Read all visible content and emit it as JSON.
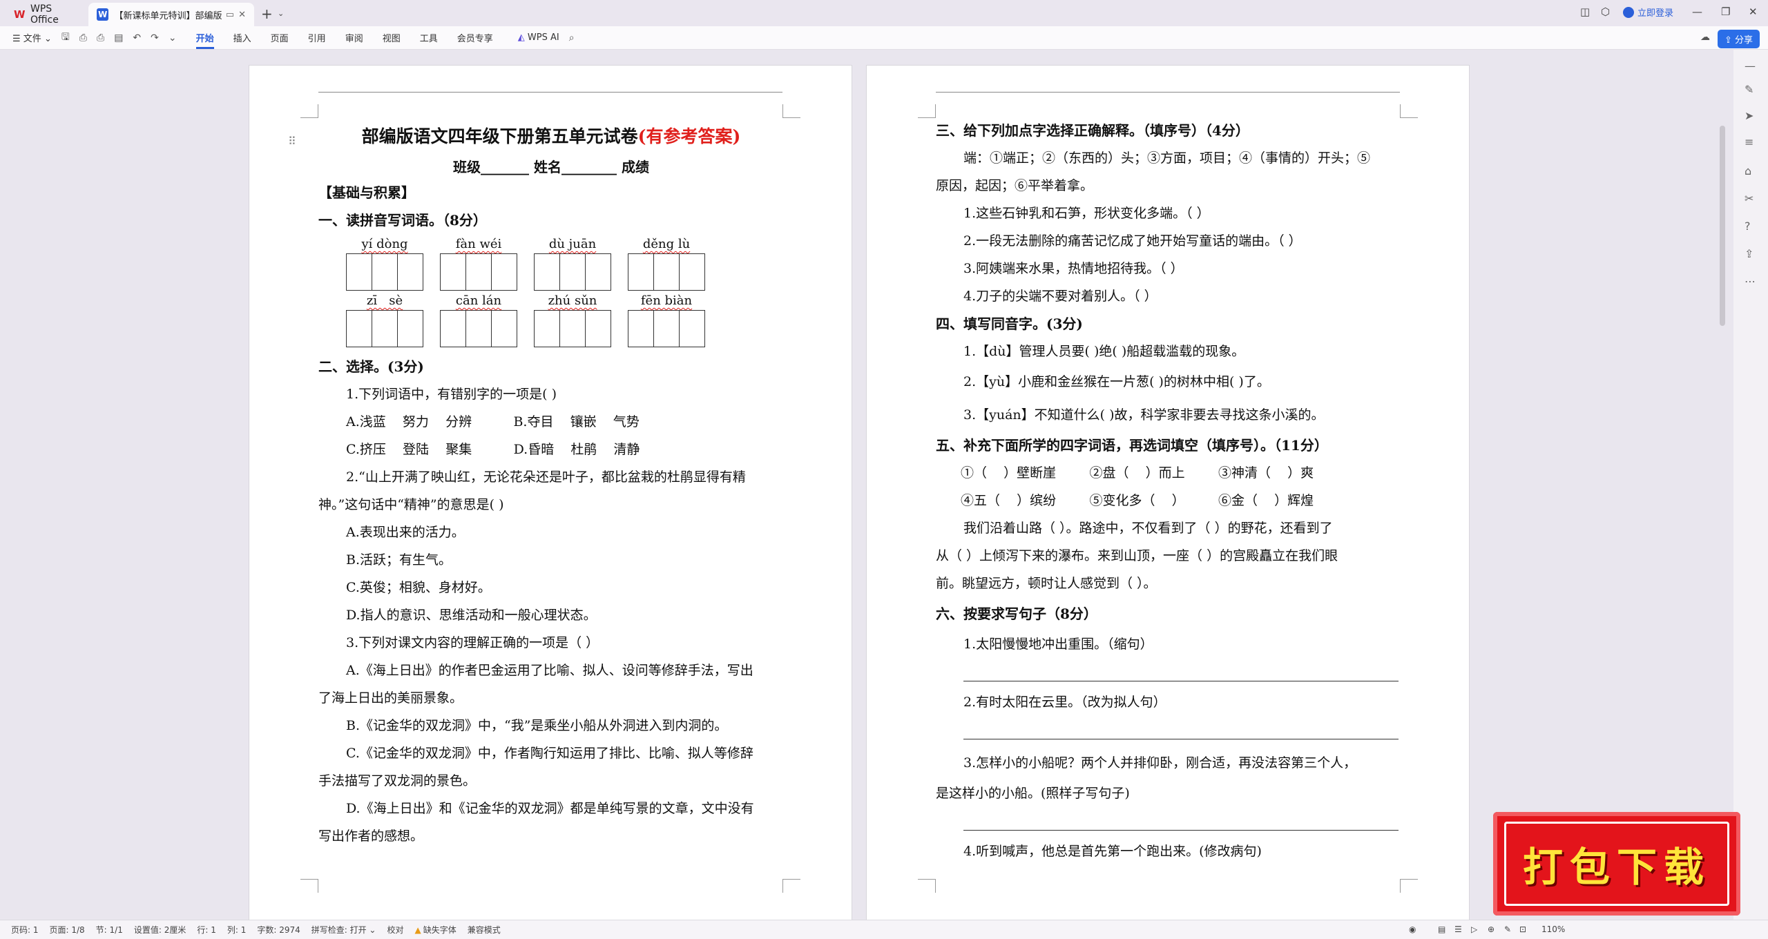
{
  "titlebar": {
    "home_tab": "WPS Office",
    "doc_tab": "【新课标单元特训】部编版语",
    "login": "立即登录"
  },
  "toolbar": {
    "file": "文件",
    "tabs": [
      "开始",
      "插入",
      "页面",
      "引用",
      "审阅",
      "视图",
      "工具",
      "会员专享"
    ],
    "active_tab": "开始",
    "ai": "WPS AI",
    "share": "分享"
  },
  "page_left": {
    "title_main": "部编版语文四年级下册第五单元试卷",
    "title_red": "(有参考答案)",
    "subtitle": "班级_______ 姓名________ 成绩",
    "part": "【基础与积累】",
    "sec1": "一、读拼音写词语。（8分）",
    "pinyin_row1": [
      "yí dòng",
      "fàn wéi",
      "dù juān",
      "děng lù"
    ],
    "pinyin_row2": [
      "zī   sè",
      "cān lán",
      "zhú sǔn",
      "fēn biàn"
    ],
    "sec2": "二、选择。(3分)",
    "q1": "1.下列词语中，有错别字的一项是(     )",
    "q1_a": "A.浅蓝    努力    分辨          B.夺目    镶嵌    气势",
    "q1_c": "C.挤压    登陆    聚集          D.昏暗    杜鹃    清静",
    "q2_l1": "2.“山上开满了映山红，无论花朵还是叶子，都比盆栽的杜鹃显得有精",
    "q2_l2": "神。”这句话中“精神”的意思是(      )",
    "q2_a": "A.表现出来的活力。",
    "q2_b": "B.活跃；有生气。",
    "q2_c": "C.英俊；相貌、身材好。",
    "q2_d": "D.指人的意识、思维活动和一般心理状态。",
    "q3": "3.下列对课文内容的理解正确的一项是（       ）",
    "q3_a1": "A.《海上日出》的作者巴金运用了比喻、拟人、设问等修辞手法，写出",
    "q3_a2": "了海上日出的美丽景象。",
    "q3_b": "B.《记金华的双龙洞》中，“我”是乘坐小船从外洞进入到内洞的。",
    "q3_c1": "C.《记金华的双龙洞》中，作者陶行知运用了排比、比喻、拟人等修辞",
    "q3_c2": "手法描写了双龙洞的景色。",
    "q3_d1": "D.《海上日出》和《记金华的双龙洞》都是单纯写景的文章，文中没有",
    "q3_d2": "写出作者的感想。"
  },
  "page_right": {
    "sec3": "三、给下列加点字选择正确解释。（填序号）（4分）",
    "s3_l1": "端：①端正；②（东西的）头；③方面，项目；④（事情的）开头；⑤",
    "s3_l2": "原因，起因；⑥平举着拿。",
    "s3_q1": "1.这些石钟乳和石笋，形状变化多端。（     ）",
    "s3_q2": "2.一段无法删除的痛苦记忆成了她开始写童话的端由。（     ）",
    "s3_q3": "3.阿姨端来水果，热情地招待我。（     ）",
    "s3_q4": "4.刀子的尖端不要对着别人。（     ）",
    "sec4": "四、填写同音字。(3分)",
    "s4_q1": "1.【dù】管理人员要(      )绝(      )船超载滥载的现象。",
    "s4_q2": "2.【yù】小鹿和金丝猴在一片葱(      )的树林中相(      )了。",
    "s4_q3": "3.【yuán】不知道什么(      )故，科学家非要去寻找这条小溪的。",
    "sec5": "五、补充下面所学的四字词语，再选词填空（填序号）。（11分）",
    "s5_l1": "①（    ）壁断崖        ②盘（    ）而上        ③神清（    ）爽",
    "s5_l2": "④五（    ）缤纷        ⑤变化多（    ）        ⑥金（    ）辉煌",
    "s5_p1": "我们沿着山路（    ）。路途中，不仅看到了（    ）的野花，还看到了",
    "s5_p2": "从（    ）上倾泻下来的瀑布。来到山顶，一座（    ）的宫殿矗立在我们眼",
    "s5_p3": "前。眺望远方，顿时让人感觉到（    ）。",
    "sec6": "六、按要求写句子（8分）",
    "s6_q1": "1.太阳慢慢地冲出重围。（缩句）",
    "s6_q2": "2.有时太阳在云里。（改为拟人句）",
    "s6_q3_l1": "3.怎样小的小船呢？两个人并排仰卧，刚合适，再没法容第三个人，",
    "s6_q3_l2": "是这样小的小船。(照样子写句子)",
    "s6_q4": "4.听到喊声，他总是首先第一个跑出来。(修改病句)"
  },
  "statusbar": {
    "page_code": "页码: 1",
    "pages": "页面: 1/8",
    "section": "节: 1/1",
    "setting": "设置值: 2厘米",
    "row": "行: 1",
    "col": "列: 1",
    "words": "字数: 2974",
    "spell": "拼写检查: 打开",
    "proof": "校对",
    "missing_font": "缺失字体",
    "compat": "兼容模式",
    "zoom": "110%"
  },
  "stamp": {
    "text": "打包下载"
  }
}
